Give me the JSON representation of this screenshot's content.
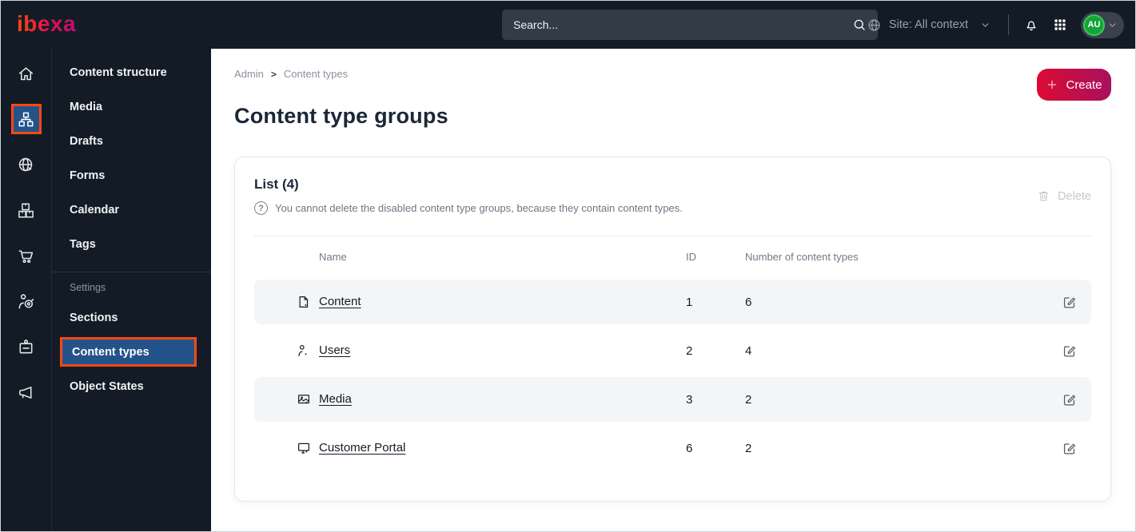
{
  "topbar": {
    "logo_text": "ibexa",
    "search": {
      "placeholder": "Search...",
      "icon": "search-icon"
    },
    "site_selector": {
      "label": "Site: All context",
      "icon": "globe-icon",
      "chevron": "chevron-down-icon"
    },
    "notification_icon": "bell-icon",
    "apps_icon": "grid-icon",
    "avatar": {
      "initials": "AU"
    }
  },
  "icon_rail": {
    "items": [
      {
        "icon": "home-icon",
        "active": false
      },
      {
        "icon": "sitemap-icon",
        "active": true
      },
      {
        "icon": "globe-cursor-icon",
        "active": false
      },
      {
        "icon": "packages-icon",
        "active": false
      },
      {
        "icon": "cart-icon",
        "active": false
      },
      {
        "icon": "person-target-icon",
        "active": false
      },
      {
        "icon": "badge-icon",
        "active": false
      },
      {
        "icon": "megaphone-icon",
        "active": false
      }
    ]
  },
  "sidebar": {
    "items": [
      {
        "label": "Content structure"
      },
      {
        "label": "Media"
      },
      {
        "label": "Drafts"
      },
      {
        "label": "Forms"
      },
      {
        "label": "Calendar"
      },
      {
        "label": "Tags"
      }
    ],
    "settings": {
      "label": "Settings",
      "items": [
        {
          "label": "Sections",
          "active": false
        },
        {
          "label": "Content types",
          "active": true
        },
        {
          "label": "Object States",
          "active": false
        }
      ]
    }
  },
  "main": {
    "breadcrumb": {
      "items": [
        "Admin",
        "Content types"
      ],
      "separator": ">"
    },
    "create_button": "Create",
    "page_title": "Content type groups"
  },
  "card": {
    "list_title": "List (4)",
    "info_icon": "?",
    "info_text": "You cannot delete the disabled content type groups, because they contain content types.",
    "delete_button": "Delete"
  },
  "table": {
    "headers": {
      "name": "Name",
      "id": "ID",
      "count": "Number of content types"
    },
    "rows": [
      {
        "icon": "file-icon",
        "name": "Content",
        "id": "1",
        "count": "6"
      },
      {
        "icon": "user-icon",
        "name": "Users",
        "id": "2",
        "count": "4"
      },
      {
        "icon": "image-icon",
        "name": "Media",
        "id": "3",
        "count": "2"
      },
      {
        "icon": "monitor-icon",
        "name": "Customer Portal",
        "id": "6",
        "count": "2"
      }
    ]
  },
  "colors": {
    "topbar_bg": "#131c26",
    "accent_orange": "#ff4713",
    "active_item_blue": "#24538a",
    "create_gradient": [
      "#dc0b33",
      "#a8115f"
    ],
    "avatar_green": "#13a438",
    "row_alt_bg": "#f4f5f7"
  }
}
